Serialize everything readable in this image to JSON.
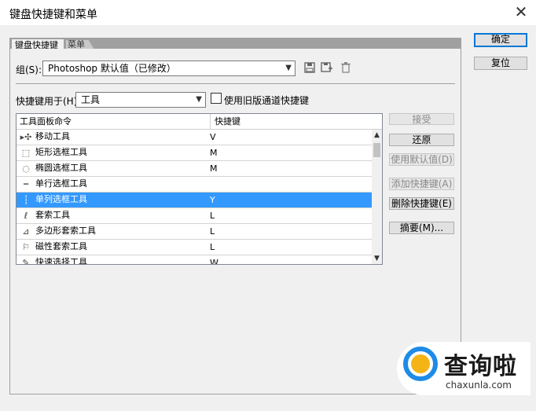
{
  "window": {
    "title": "键盘快捷键和菜单",
    "close_glyph": "✕"
  },
  "tabs": [
    {
      "label": "键盘快捷键",
      "active": true
    },
    {
      "label": "菜单",
      "active": false
    }
  ],
  "right_buttons": {
    "ok": "确定",
    "reset": "复位"
  },
  "group": {
    "label": "组(S):",
    "value": "Photoshop 默认值（已修改）",
    "icons": [
      "save-icon",
      "save-as-icon",
      "delete-icon"
    ]
  },
  "shortcut_for": {
    "label": "快捷键用于(H):",
    "value": "工具",
    "legacy_checkbox_label": "使用旧版通道快捷键",
    "legacy_checked": false
  },
  "table": {
    "headers": [
      "工具面板命令",
      "快捷键"
    ],
    "rows": [
      {
        "icon": "▸✣",
        "command": "移动工具",
        "key": "V",
        "selected": false
      },
      {
        "icon": "⬚",
        "command": "矩形选框工具",
        "key": "M",
        "selected": false
      },
      {
        "icon": "◌",
        "command": "椭圆选框工具",
        "key": "M",
        "selected": false
      },
      {
        "icon": "┅",
        "command": "单行选框工具",
        "key": "",
        "selected": false
      },
      {
        "icon": "┆",
        "command": "单列选框工具",
        "key": "Y",
        "selected": true
      },
      {
        "icon": "ℓ",
        "command": "套索工具",
        "key": "L",
        "selected": false
      },
      {
        "icon": "⊿",
        "command": "多边形套索工具",
        "key": "L",
        "selected": false
      },
      {
        "icon": "⚐",
        "command": "磁性套索工具",
        "key": "L",
        "selected": false
      },
      {
        "icon": "✎",
        "command": "快速选择工具",
        "key": "W",
        "selected": false
      }
    ]
  },
  "action_buttons": {
    "accept": "接受",
    "undo": "还原",
    "use_default": "使用默认值(D)",
    "add_shortcut": "添加快捷键(A)",
    "delete_shortcut": "删除快捷键(E)",
    "summarize": "摘要(M)..."
  },
  "watermark": {
    "brand": "查询啦",
    "domain": "chaxunla.com"
  }
}
